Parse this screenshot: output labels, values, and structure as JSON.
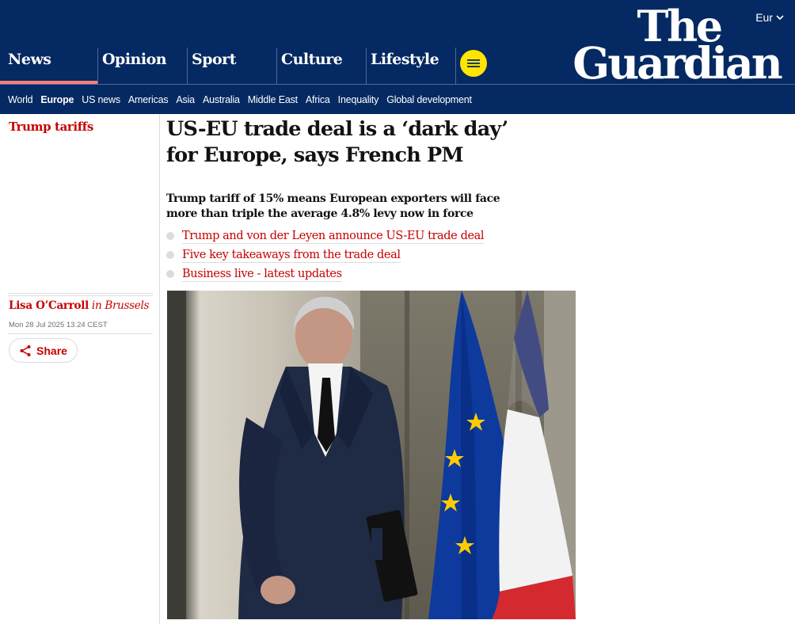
{
  "edition": {
    "label": "Eur"
  },
  "brand": {
    "line1": "The",
    "line2": "Guardian"
  },
  "pillars": [
    {
      "label": "News",
      "active": true
    },
    {
      "label": "Opinion",
      "active": false
    },
    {
      "label": "Sport",
      "active": false
    },
    {
      "label": "Culture",
      "active": false
    },
    {
      "label": "Lifestyle",
      "active": false
    }
  ],
  "subnav": [
    {
      "label": "World",
      "active": false
    },
    {
      "label": "Europe",
      "active": true
    },
    {
      "label": "US news",
      "active": false
    },
    {
      "label": "Americas",
      "active": false
    },
    {
      "label": "Asia",
      "active": false
    },
    {
      "label": "Australia",
      "active": false
    },
    {
      "label": "Middle East",
      "active": false
    },
    {
      "label": "Africa",
      "active": false
    },
    {
      "label": "Inequality",
      "active": false
    },
    {
      "label": "Global development",
      "active": false
    }
  ],
  "article": {
    "kicker": "Trump tariffs",
    "headline": "US-EU trade deal is a ‘dark day’ for Europe, says French PM",
    "standfirst": "Trump tariff of 15% means European exporters will face more than triple the average 4.8% levy now in force",
    "related": [
      "Trump and von der Leyen announce US-EU trade deal",
      "Five key takeaways from the trade deal",
      "Business live - latest updates"
    ],
    "author": "Lisa O’Carroll",
    "location": "in Brussels",
    "date": "Mon 28 Jul 2025 13.24 CEST",
    "share_label": "Share"
  },
  "colors": {
    "masthead": "#052962",
    "accent_red": "#c70000",
    "menu_yellow": "#ffe500",
    "news_underline": "#ff7f7f",
    "eu_blue": "#0d3a9c",
    "eu_star": "#ffcc00",
    "fr_blue": "#2a3474",
    "fr_red": "#d42a2f"
  },
  "icons": {
    "edition_chevron": "chevron-down-icon",
    "menu": "hamburger-menu-icon",
    "share": "share-icon"
  }
}
